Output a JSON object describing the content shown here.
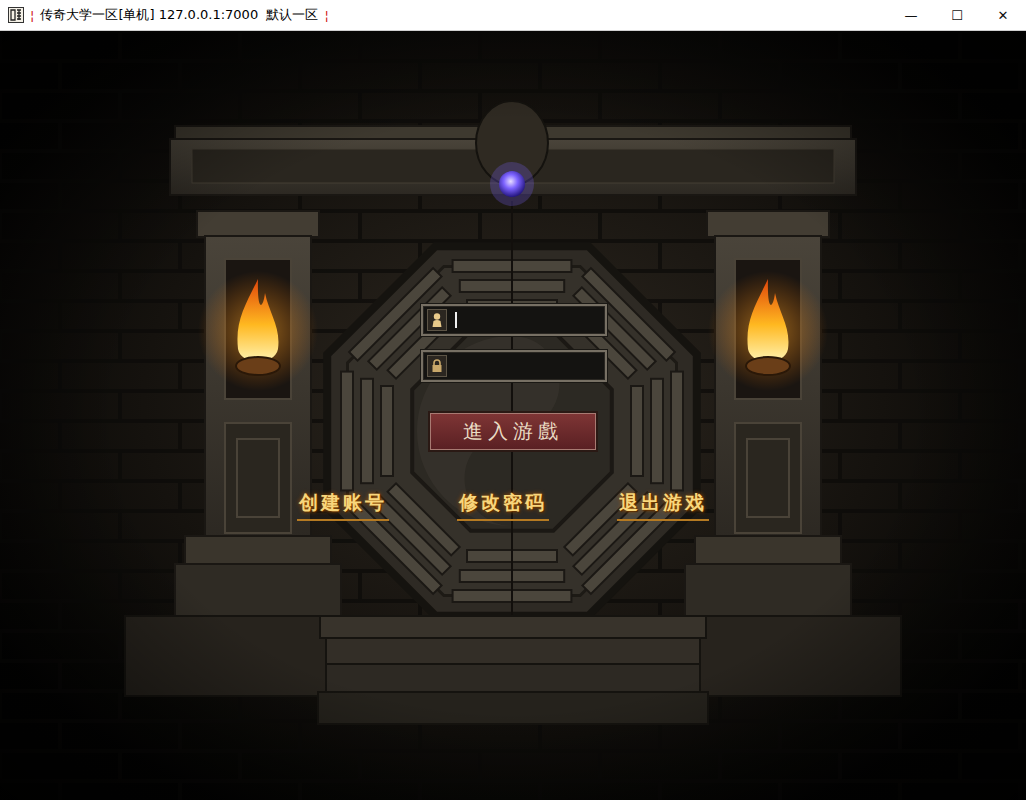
{
  "window": {
    "title": "传奇大学一区[单机] 127.0.0.1:7000  默认一区",
    "separators": [
      "¦",
      "¦"
    ],
    "controls": [
      "—",
      "☐",
      "✕"
    ]
  },
  "login": {
    "fields": [
      {
        "kind": "account",
        "value": "",
        "focused": true
      },
      {
        "kind": "password",
        "value": "",
        "focused": false
      }
    ],
    "submit": "進入游戲"
  },
  "links": [
    "创建账号",
    "修改密码",
    "退出游戏"
  ]
}
